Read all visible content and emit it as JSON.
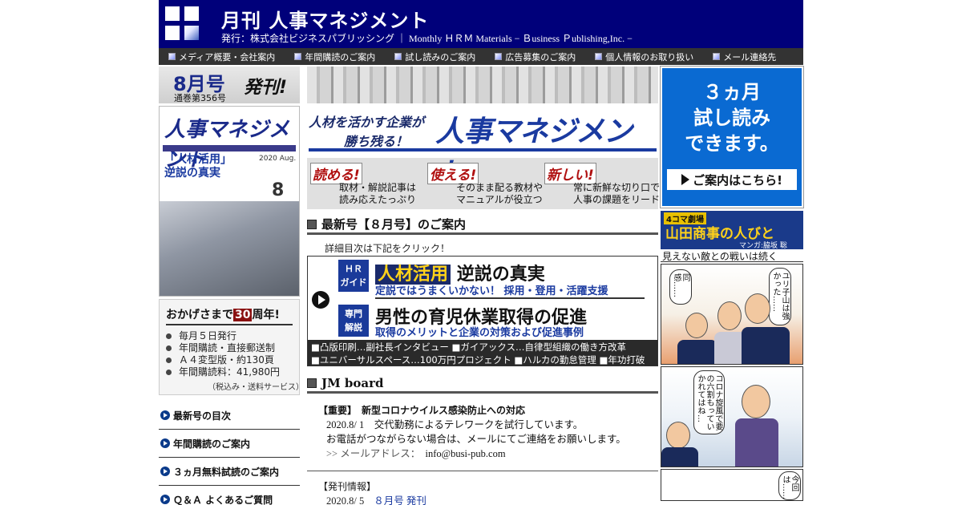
{
  "header": {
    "site_title": "月刊 人事マネジメント",
    "publisher": "発行：株式会社ビジネスパブリッシング ｜ Monthly ＨＲＭ Materials − Ｂusiness Ｐublishing,Inc. −"
  },
  "topnav": [
    {
      "label": "メディア概要・会社案内"
    },
    {
      "label": "年間購読のご案内"
    },
    {
      "label": "試し読みのご案内"
    },
    {
      "label": "広告募集のご案内"
    },
    {
      "label": "個人情報のお取り扱い"
    },
    {
      "label": "メール連絡先"
    }
  ],
  "issue": {
    "month": "8月号",
    "volume": "通巻第356号",
    "published": "発刊!",
    "cover_mag": "人事マネジメント",
    "cover_feature_1": "「人材活用」",
    "cover_feature_2": "逆説の真実",
    "cover_year": "2020 Aug.",
    "cover_num": "8"
  },
  "anniversary": {
    "prefix": "おかげさまで",
    "years": "30",
    "suffix": "周年!",
    "items": [
      {
        "text": "毎月５日発行"
      },
      {
        "text": "年間購読・直接郵送制"
      },
      {
        "text": "Ａ４変型版・約130頁"
      },
      {
        "text": "年間購読料：41,980円"
      }
    ],
    "note": "（税込み・送料サービス）"
  },
  "side_links": [
    {
      "label": "最新号の目次"
    },
    {
      "label": "年間購読のご案内"
    },
    {
      "label": "３ヵ月無料試読のご案内"
    },
    {
      "label": "Ｑ＆Ａ よくあるご質問"
    }
  ],
  "banner": {
    "slogan_1": "人材を活かす企業が",
    "slogan_2": "勝ち残る！",
    "big_title": "人事マネジメント",
    "features": [
      {
        "tag": "読める!",
        "line1": "取材・解説記事は",
        "line2": "読み応えたっぷり"
      },
      {
        "tag": "使える!",
        "line1": "そのまま配る教材や",
        "line2": "マニュアルが役立つ"
      },
      {
        "tag": "新しい!",
        "line1": "常に新鮮な切り口で",
        "line2": "人事の課題をリード"
      }
    ]
  },
  "latest": {
    "section_title": "最新号【８月号】のご案内",
    "click_note": "詳細目次は下記をクリック！",
    "hr_badge_1": "ＨＲ",
    "hr_badge_2": "ガイド",
    "toc_h1_hl": "人材活用",
    "toc_h1_rest": "逆説の真実",
    "toc_s1": "定説ではうまくいかない！ 採用・登用・活躍支援",
    "sp_badge_1": "専門",
    "sp_badge_2": "解説",
    "toc_h2": "男性の育児休業取得の促進",
    "toc_s2": "取得のメリットと企業の対策および促進事例",
    "toc_bar_1": "■凸版印刷…副社長インタビュー ■ガイアックス…自律型組織の働き方改革",
    "toc_bar_2": "■ユニバーサルスペース…100万円プロジェクト ■ハルカの勤怠管理 ■年功打破"
  },
  "jm_board": {
    "section_title": "JM board",
    "notice_label": "【重要】　新型コロナウイルス感染防止への対応",
    "notice_line1": "2020.8/ 1　交代勤務によるテレワークを試行しています。",
    "notice_line2": "お電話がつながらない場合は、メールにてご連絡をお願いします。",
    "mail_prefix": ">> メールアドレス：",
    "mail_address": "info@busi-pub.com",
    "release_label": "【発刊情報】",
    "release_date": "2020.8/ 5",
    "release_link": "８月号 発刊"
  },
  "right": {
    "trial_line1": "３ヵ月",
    "trial_line2": "試し読み",
    "trial_line3": "できます。",
    "trial_button": "ご案内はこちら!",
    "manga_tag": "4コマ劇場",
    "manga_title": "山田商事の人びと",
    "manga_author": "マンガ:脇坂 聡",
    "manga_subtitle": "見えない敵との戦いは続く",
    "bubble_1": "同感……",
    "bubble_2": "ユリ子山は強かった……",
    "bubble_3": "コロナ旋風で要の六割もっていかれてはね…",
    "bubble_4": "今回は……"
  },
  "colors": {
    "header_bg": "#00007a",
    "nav_bg": "#333333",
    "accent_blue": "#1a3aa0",
    "trial_blue": "#0a6ad2"
  }
}
